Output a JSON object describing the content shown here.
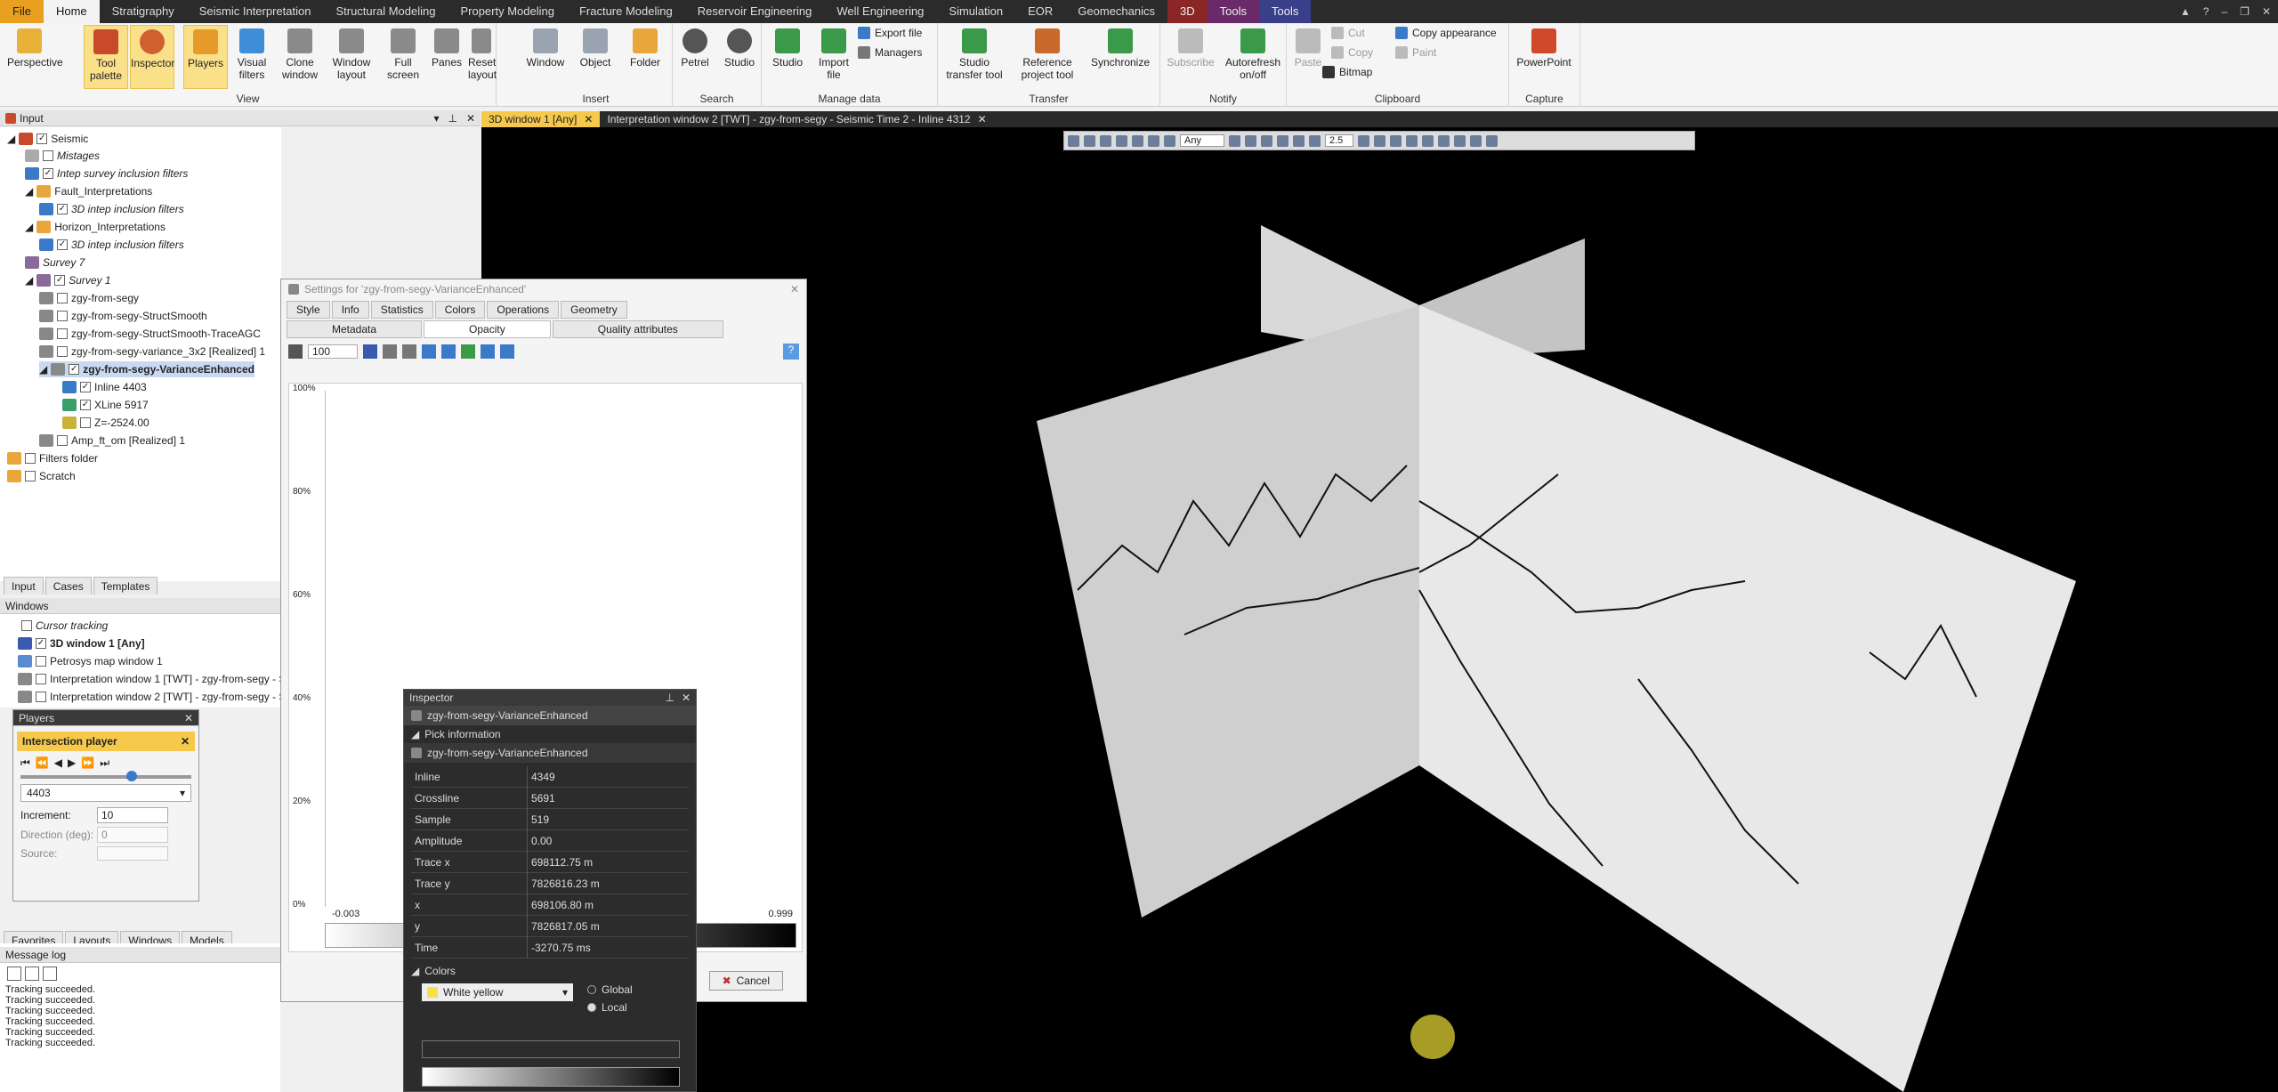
{
  "menubar": {
    "items": [
      "File",
      "Home",
      "Stratigraphy",
      "Seismic Interpretation",
      "Structural Modeling",
      "Property Modeling",
      "Fracture Modeling",
      "Reservoir Engineering",
      "Well Engineering",
      "Simulation",
      "EOR",
      "Geomechanics",
      "3D",
      "Tools",
      "Tools"
    ]
  },
  "ribbon": {
    "view_buttons": [
      "Perspective",
      "Tool palette",
      "Inspector",
      "Players",
      "Visual filters",
      "Clone window",
      "Window layout",
      "Full screen",
      "Panes",
      "Reset layout"
    ],
    "view_label": "View",
    "insert_buttons": [
      "Window",
      "Object",
      "Folder"
    ],
    "insert_label": "Insert",
    "search_buttons": [
      "Petrel",
      "Studio"
    ],
    "search_label": "Search",
    "manage_buttons": [
      "Studio",
      "Import file"
    ],
    "manage_small": [
      "Export file",
      "Managers"
    ],
    "manage_label": "Manage data",
    "transfer_buttons": [
      "Studio transfer tool",
      "Reference project tool",
      "Synchronize"
    ],
    "transfer_label": "Transfer",
    "notify_buttons": [
      "Subscribe",
      "Autorefresh on/off"
    ],
    "notify_label": "Notify",
    "clipboard_paste": "Paste",
    "clipboard_small": [
      "Cut",
      "Copy",
      "Bitmap",
      "Copy appearance",
      "Paint"
    ],
    "clipboard_label": "Clipboard",
    "capture_button": "PowerPoint",
    "capture_label": "Capture"
  },
  "input_panel": {
    "title": "Input",
    "tree": [
      "Seismic",
      "Mistages",
      "Intep survey inclusion filters",
      "Fault_Interpretations",
      "3D intep inclusion filters",
      "Horizon_Interpretations",
      "3D intep inclusion filters",
      "Survey 7",
      "Survey 1",
      "zgy-from-segy",
      "zgy-from-segy-StructSmooth",
      "zgy-from-segy-StructSmooth-TraceAGC",
      "zgy-from-segy-variance_3x2 [Realized] 1",
      "zgy-from-segy-VarianceEnhanced",
      "Inline 4403",
      "XLine 5917",
      "Z=-2524.00",
      "Amp_ft_om [Realized] 1",
      "Filters folder",
      "Scratch"
    ],
    "tabs": [
      "Input",
      "Cases",
      "Templates"
    ]
  },
  "windows_panel": {
    "title": "Windows",
    "items": [
      "Cursor tracking",
      "3D window 1 [Any]",
      "Petrosys map window 1",
      "Interpretation window 1 [TWT] - zgy-from-segy - Se",
      "Interpretation window 2 [TWT] - zgy-from-segy - Se"
    ],
    "bottom_tabs": [
      "Favorites",
      "Layouts",
      "Windows",
      "Models"
    ]
  },
  "players": {
    "title": "Players",
    "player": "Intersection player",
    "value": "4403",
    "increment_label": "Increment:",
    "increment_value": "10",
    "direction_label": "Direction (deg):",
    "direction_value": "0",
    "source_label": "Source:"
  },
  "message_log": {
    "title": "Message log",
    "lines": [
      "Tracking succeeded.",
      "Tracking succeeded.",
      "Tracking succeeded.",
      "Tracking succeeded.",
      "Tracking succeeded.",
      "Tracking succeeded."
    ]
  },
  "doc_tabs": [
    "3D window 1 [Any]",
    "Interpretation window 2 [TWT] - zgy-from-segy - Seismic Time 2 - Inline 4312"
  ],
  "viewtool": {
    "domain": "Any",
    "zscale": "2.5"
  },
  "settings": {
    "title": "Settings for 'zgy-from-segy-VarianceEnhanced'",
    "tabs_row1": [
      "Style",
      "Info",
      "Statistics",
      "Colors",
      "Operations",
      "Geometry"
    ],
    "tabs_row2": [
      "Metadata",
      "Opacity",
      "Quality attributes"
    ],
    "zoom": "100",
    "y_ticks": [
      "100%",
      "80%",
      "60%",
      "40%",
      "20%",
      "0%"
    ],
    "x_min": "-0.003",
    "x_max": "0.999",
    "cancel": "Cancel"
  },
  "inspector": {
    "title": "Inspector",
    "object": "zgy-from-segy-VarianceEnhanced",
    "section": "Pick information",
    "sub_object": "zgy-from-segy-VarianceEnhanced",
    "rows": [
      {
        "k": "Inline",
        "v": "4349"
      },
      {
        "k": "Crossline",
        "v": "5691"
      },
      {
        "k": "Sample",
        "v": "519"
      },
      {
        "k": "Amplitude",
        "v": "0.00"
      },
      {
        "k": "Trace x",
        "v": "698112.75 m"
      },
      {
        "k": "Trace y",
        "v": "7826816.23 m"
      },
      {
        "k": "x",
        "v": "698106.80 m"
      },
      {
        "k": "y",
        "v": "7826817.05 m"
      },
      {
        "k": "Time",
        "v": "-3270.75 ms"
      }
    ],
    "colors_section": "Colors",
    "colortable": "White yellow",
    "global": "Global",
    "local": "Local"
  },
  "colors": {
    "accent": "#f6c94c",
    "viewport": "#000000",
    "panel_dark": "#2c2c2c"
  }
}
